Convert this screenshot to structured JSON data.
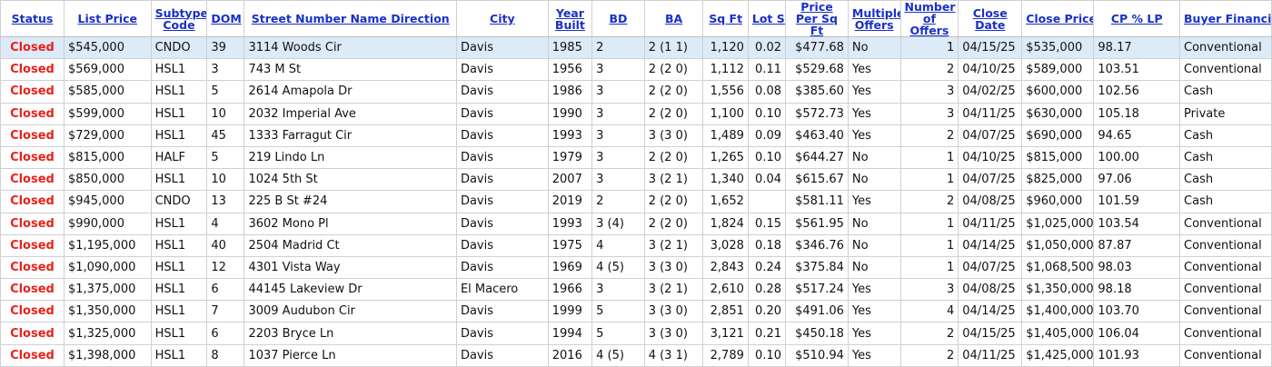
{
  "headers": {
    "status": "Status",
    "list_price": "List Price",
    "subtype_code": "Subtype Code",
    "dom": "DOM",
    "street": "Street Number Name Direction",
    "city": "City",
    "year_built": "Year Built",
    "bd": "BD",
    "ba": "BA",
    "sq_ft": "Sq Ft",
    "lot_sz": "Lot Sz",
    "price_per_sqft": "Price Per Sq Ft",
    "multiple_offers": "Multiple Offers",
    "number_of_offers": "Number of Offers",
    "close_date": "Close Date",
    "close_price": "Close Price",
    "cp_lp": "CP % LP",
    "buyer_financing": "Buyer Financing"
  },
  "colors": {
    "header_link": "#1a30c8",
    "status_closed": "#e8221b",
    "selected_row": "#ddeaf7"
  },
  "rows": [
    {
      "status": "Closed",
      "list_price": "$545,000",
      "subtype": "CNDO",
      "dom": "39",
      "street": "3114 Woods Cir",
      "city": "Davis",
      "year": "1985",
      "bd": "2",
      "ba": "2 (1 1)",
      "sqft": "1,120",
      "lot": "0.02",
      "ppsf": "$477.68",
      "multi": "No",
      "offers": "1",
      "close_date": "04/15/25",
      "close_price": "$535,000",
      "cplp": "98.17",
      "financing": "Conventional"
    },
    {
      "status": "Closed",
      "list_price": "$569,000",
      "subtype": "HSL1",
      "dom": "3",
      "street": "743 M St",
      "city": "Davis",
      "year": "1956",
      "bd": "3",
      "ba": "2 (2 0)",
      "sqft": "1,112",
      "lot": "0.11",
      "ppsf": "$529.68",
      "multi": "Yes",
      "offers": "2",
      "close_date": "04/10/25",
      "close_price": "$589,000",
      "cplp": "103.51",
      "financing": "Conventional"
    },
    {
      "status": "Closed",
      "list_price": "$585,000",
      "subtype": "HSL1",
      "dom": "5",
      "street": "2614 Amapola Dr",
      "city": "Davis",
      "year": "1986",
      "bd": "3",
      "ba": "2 (2 0)",
      "sqft": "1,556",
      "lot": "0.08",
      "ppsf": "$385.60",
      "multi": "Yes",
      "offers": "3",
      "close_date": "04/02/25",
      "close_price": "$600,000",
      "cplp": "102.56",
      "financing": "Cash"
    },
    {
      "status": "Closed",
      "list_price": "$599,000",
      "subtype": "HSL1",
      "dom": "10",
      "street": "2032 Imperial Ave",
      "city": "Davis",
      "year": "1990",
      "bd": "3",
      "ba": "2 (2 0)",
      "sqft": "1,100",
      "lot": "0.10",
      "ppsf": "$572.73",
      "multi": "Yes",
      "offers": "3",
      "close_date": "04/11/25",
      "close_price": "$630,000",
      "cplp": "105.18",
      "financing": "Private"
    },
    {
      "status": "Closed",
      "list_price": "$729,000",
      "subtype": "HSL1",
      "dom": "45",
      "street": "1333 Farragut Cir",
      "city": "Davis",
      "year": "1993",
      "bd": "3",
      "ba": "3 (3 0)",
      "sqft": "1,489",
      "lot": "0.09",
      "ppsf": "$463.40",
      "multi": "Yes",
      "offers": "2",
      "close_date": "04/07/25",
      "close_price": "$690,000",
      "cplp": "94.65",
      "financing": "Cash"
    },
    {
      "status": "Closed",
      "list_price": "$815,000",
      "subtype": "HALF",
      "dom": "5",
      "street": "219 Lindo Ln",
      "city": "Davis",
      "year": "1979",
      "bd": "3",
      "ba": "2 (2 0)",
      "sqft": "1,265",
      "lot": "0.10",
      "ppsf": "$644.27",
      "multi": "No",
      "offers": "1",
      "close_date": "04/10/25",
      "close_price": "$815,000",
      "cplp": "100.00",
      "financing": "Cash"
    },
    {
      "status": "Closed",
      "list_price": "$850,000",
      "subtype": "HSL1",
      "dom": "10",
      "street": "1024 5th St",
      "city": "Davis",
      "year": "2007",
      "bd": "3",
      "ba": "3 (2 1)",
      "sqft": "1,340",
      "lot": "0.04",
      "ppsf": "$615.67",
      "multi": "No",
      "offers": "1",
      "close_date": "04/07/25",
      "close_price": "$825,000",
      "cplp": "97.06",
      "financing": "Cash"
    },
    {
      "status": "Closed",
      "list_price": "$945,000",
      "subtype": "CNDO",
      "dom": "13",
      "street": "225 B St #24",
      "city": "Davis",
      "year": "2019",
      "bd": "2",
      "ba": "2 (2 0)",
      "sqft": "1,652",
      "lot": "",
      "ppsf": "$581.11",
      "multi": "Yes",
      "offers": "2",
      "close_date": "04/08/25",
      "close_price": "$960,000",
      "cplp": "101.59",
      "financing": "Cash"
    },
    {
      "status": "Closed",
      "list_price": "$990,000",
      "subtype": "HSL1",
      "dom": "4",
      "street": "3602 Mono Pl",
      "city": "Davis",
      "year": "1993",
      "bd": "3 (4)",
      "ba": "2 (2 0)",
      "sqft": "1,824",
      "lot": "0.15",
      "ppsf": "$561.95",
      "multi": "No",
      "offers": "1",
      "close_date": "04/11/25",
      "close_price": "$1,025,000",
      "cplp": "103.54",
      "financing": "Conventional"
    },
    {
      "status": "Closed",
      "list_price": "$1,195,000",
      "subtype": "HSL1",
      "dom": "40",
      "street": "2504 Madrid Ct",
      "city": "Davis",
      "year": "1975",
      "bd": "4",
      "ba": "3 (2 1)",
      "sqft": "3,028",
      "lot": "0.18",
      "ppsf": "$346.76",
      "multi": "No",
      "offers": "1",
      "close_date": "04/14/25",
      "close_price": "$1,050,000",
      "cplp": "87.87",
      "financing": "Conventional"
    },
    {
      "status": "Closed",
      "list_price": "$1,090,000",
      "subtype": "HSL1",
      "dom": "12",
      "street": "4301 Vista Way",
      "city": "Davis",
      "year": "1969",
      "bd": "4 (5)",
      "ba": "3 (3 0)",
      "sqft": "2,843",
      "lot": "0.24",
      "ppsf": "$375.84",
      "multi": "No",
      "offers": "1",
      "close_date": "04/07/25",
      "close_price": "$1,068,500",
      "cplp": "98.03",
      "financing": "Conventional"
    },
    {
      "status": "Closed",
      "list_price": "$1,375,000",
      "subtype": "HSL1",
      "dom": "6",
      "street": "44145 Lakeview Dr",
      "city": "El Macero",
      "year": "1966",
      "bd": "3",
      "ba": "3 (2 1)",
      "sqft": "2,610",
      "lot": "0.28",
      "ppsf": "$517.24",
      "multi": "Yes",
      "offers": "3",
      "close_date": "04/08/25",
      "close_price": "$1,350,000",
      "cplp": "98.18",
      "financing": "Conventional"
    },
    {
      "status": "Closed",
      "list_price": "$1,350,000",
      "subtype": "HSL1",
      "dom": "7",
      "street": "3009 Audubon Cir",
      "city": "Davis",
      "year": "1999",
      "bd": "5",
      "ba": "3 (3 0)",
      "sqft": "2,851",
      "lot": "0.20",
      "ppsf": "$491.06",
      "multi": "Yes",
      "offers": "4",
      "close_date": "04/14/25",
      "close_price": "$1,400,000",
      "cplp": "103.70",
      "financing": "Conventional"
    },
    {
      "status": "Closed",
      "list_price": "$1,325,000",
      "subtype": "HSL1",
      "dom": "6",
      "street": "2203 Bryce Ln",
      "city": "Davis",
      "year": "1994",
      "bd": "5",
      "ba": "3 (3 0)",
      "sqft": "3,121",
      "lot": "0.21",
      "ppsf": "$450.18",
      "multi": "Yes",
      "offers": "2",
      "close_date": "04/15/25",
      "close_price": "$1,405,000",
      "cplp": "106.04",
      "financing": "Conventional"
    },
    {
      "status": "Closed",
      "list_price": "$1,398,000",
      "subtype": "HSL1",
      "dom": "8",
      "street": "1037 Pierce Ln",
      "city": "Davis",
      "year": "2016",
      "bd": "4 (5)",
      "ba": "4 (3 1)",
      "sqft": "2,789",
      "lot": "0.10",
      "ppsf": "$510.94",
      "multi": "Yes",
      "offers": "2",
      "close_date": "04/11/25",
      "close_price": "$1,425,000",
      "cplp": "101.93",
      "financing": "Conventional"
    }
  ]
}
